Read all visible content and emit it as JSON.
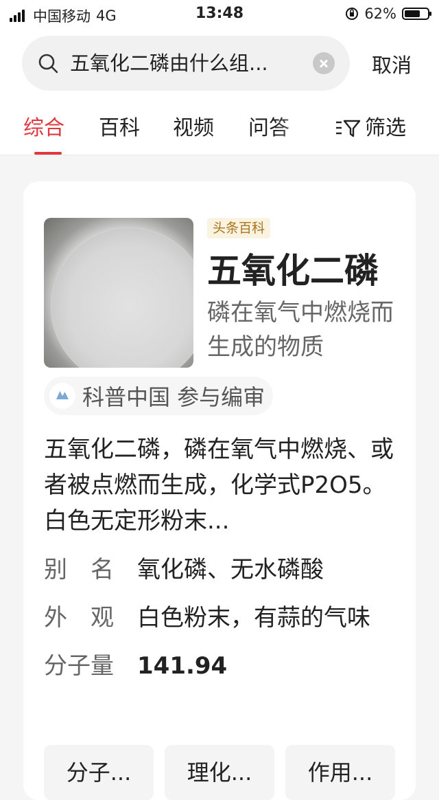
{
  "status_bar": {
    "carrier": "中国移动",
    "network": "4G",
    "time": "13:48",
    "battery": "62%",
    "battery_level": 0.62
  },
  "search": {
    "query": "五氧化二磷由什么组...",
    "cancel_label": "取消"
  },
  "tabs": [
    {
      "label": "综合",
      "active": true
    },
    {
      "label": "百科",
      "active": false
    },
    {
      "label": "视频",
      "active": false
    },
    {
      "label": "问答",
      "active": false
    }
  ],
  "filter_label": "筛选",
  "card": {
    "badge": "头条百科",
    "title": "五氧化二磷",
    "subtitle": "磷在氧气中燃烧而生成的物质",
    "reviewer": "科普中国 参与编审",
    "summary": "五氧化二磷，磷在氧气中燃烧、或者被点燃而生成，化学式P2O5。白色无定形粉末...",
    "info": [
      {
        "label": "别　名",
        "value": "氧化磷、无水磷酸"
      },
      {
        "label": "外　观",
        "value": "白色粉末，有蒜的气味"
      },
      {
        "label": "分子量",
        "value": "141.94"
      }
    ],
    "chips": [
      "分子...",
      "理化...",
      "作用..."
    ]
  },
  "colors": {
    "accent": "#e0383e",
    "badge_text": "#a8741a",
    "badge_bg": "#fbf3e2"
  }
}
